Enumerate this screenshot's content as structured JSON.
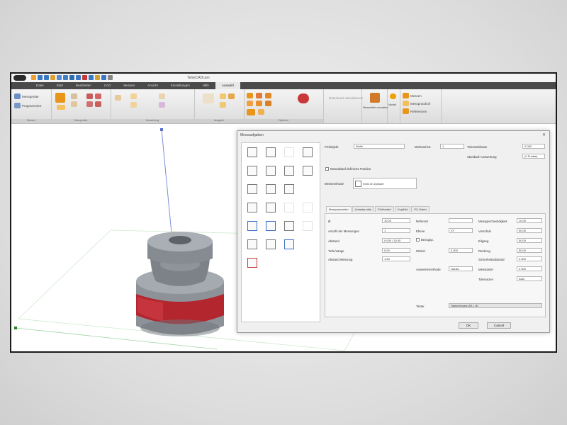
{
  "window": {
    "title": "TebisCADcam"
  },
  "tabs": [
    {
      "label": "Datei"
    },
    {
      "label": "Start"
    },
    {
      "label": "Bearbeiten"
    },
    {
      "label": "CAD"
    },
    {
      "label": "Messen"
    },
    {
      "label": "Ansicht"
    },
    {
      "label": "Einstellungen"
    },
    {
      "label": "Hilfe"
    },
    {
      "label": "Auswahl"
    }
  ],
  "ribbon": {
    "left_items": [
      {
        "label": "Messgeräte"
      },
      {
        "label": "Programmiert"
      }
    ],
    "group_labels": [
      "Messen",
      "Messpunkte",
      "Auswertung",
      "Ausgabe",
      "Optionen"
    ],
    "right_items": [
      {
        "label": "Messmittel verwalten"
      },
      {
        "label": "Datenbank aktualisieren"
      },
      {
        "label": "Modell"
      },
      {
        "label": "Messen"
      },
      {
        "label": "Messprotokoll"
      },
      {
        "label": "Referenzen"
      }
    ],
    "colors": {
      "accent": "#e8951a",
      "red": "#c0392b",
      "blue": "#2f6fb5",
      "green": "#3c9a3c"
    }
  },
  "dialog": {
    "title": "Messaufgaben",
    "close_icon": "close-icon",
    "fields": {
      "messobjekt_label": "Prüfobjekt",
      "messobjekt_value": "Welle",
      "nummer_label": "Merkmal-Nr.",
      "nummer_value": "1",
      "toleranz_label": "Toleranzklasse",
      "toleranz_value": "0.050",
      "standard_label": "Standard-Auswertung",
      "standard_value": "(0 Punkte)",
      "checkbox_label": "Messablauf definierte Position",
      "messmethode_label": "Messmethode",
      "messmethode_value": "Kreis im Zylinder"
    },
    "subtabs": [
      "Messparameter",
      "Antastpunkte",
      "Prüfbedarf",
      "Kopfbild",
      "PC-Daten"
    ],
    "params_left": [
      {
        "label": "Ø",
        "value": "10.00"
      },
      {
        "label": "Anzahl der Messungen",
        "value": "1"
      },
      {
        "label": "Abstand",
        "value": "0.000 / 10.00"
      },
      {
        "label": "Tiefe/Länge",
        "value": "5.00"
      },
      {
        "label": "Abstand Messung",
        "value": "1.50"
      }
    ],
    "params_mid": [
      {
        "label": "Referenz",
        "value": ""
      },
      {
        "label": "Ebene",
        "value": "XY"
      },
      {
        "label": "Bezug",
        "value": "Bezugsp."
      },
      {
        "label": "Winkel",
        "value": "0.000"
      },
      {
        "label": "Auswertemethode",
        "value": "Gauss"
      }
    ],
    "params_right": [
      {
        "label": "Messgeschwindigkeit",
        "value": "10.00"
      },
      {
        "label": "Vorschub",
        "value": "50.00"
      },
      {
        "label": "Eilgang",
        "value": "50.00"
      },
      {
        "label": "Rückzug",
        "value": "50.00"
      },
      {
        "label": "Sicherheitsabstand",
        "value": "2.000"
      },
      {
        "label": "Messtaster",
        "value": "2.000"
      },
      {
        "label": "Toleranzen",
        "value": "Auto"
      }
    ],
    "tool_label": "Taster",
    "tool_value": "Tastereinsatz Ø3 L 50",
    "ok_label": "OK",
    "cancel_label": "Cancel"
  }
}
